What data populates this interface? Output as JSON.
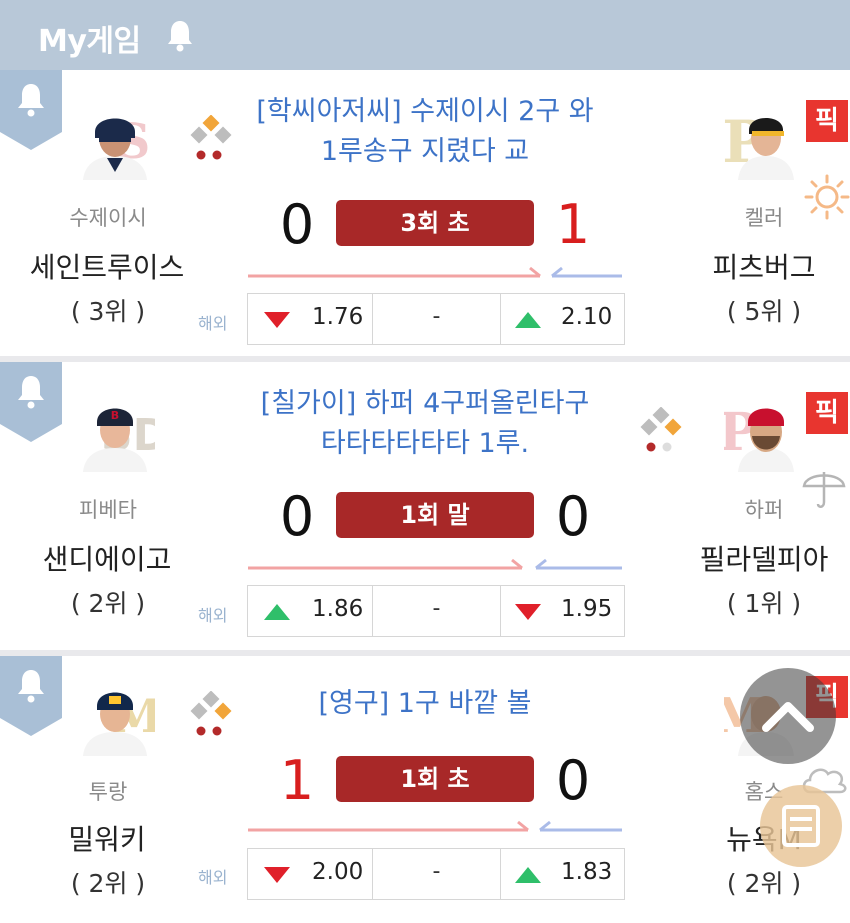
{
  "header": {
    "title": "My게임",
    "bell_icon": "bell-icon"
  },
  "colors": {
    "accent_red": "#a82828",
    "headline_blue": "#3d73c7",
    "pick_red": "#e8352f",
    "up_green": "#2fbf6a",
    "down_red": "#e0202a"
  },
  "games": [
    {
      "headline": [
        "[학씨아저씨] 수제이시 2구 와",
        "1루송구 지렸다 교"
      ],
      "inning": "3회 초",
      "away": {
        "pitcher": "수제이시",
        "team": "세인트루이스",
        "rank": "( 3위 )",
        "score": "0",
        "logo_letter": "S"
      },
      "home": {
        "pitcher": "켈러",
        "team": "피츠버그",
        "rank": "( 5위 )",
        "score": "1",
        "logo_letter": "P"
      },
      "weather": "sun-icon",
      "pick_label": "픽",
      "odds_label": "해외",
      "odds": {
        "away": "1.76",
        "draw": "-",
        "home": "2.10",
        "away_dir": "down",
        "home_dir": "up"
      }
    },
    {
      "headline": [
        "[칠가이] 하퍼 4구퍼올린타구",
        "타타타타타타 1루."
      ],
      "inning": "1회 말",
      "away": {
        "pitcher": "피베타",
        "team": "샌디에이고",
        "rank": "( 2위 )",
        "score": "0",
        "logo_letter": "SD"
      },
      "home": {
        "pitcher": "하퍼",
        "team": "필라델피아",
        "rank": "( 1위 )",
        "score": "0",
        "logo_letter": "P"
      },
      "weather": "umbrella-icon",
      "pick_label": "픽",
      "odds_label": "해외",
      "odds": {
        "away": "1.86",
        "draw": "-",
        "home": "1.95",
        "away_dir": "up",
        "home_dir": "down"
      }
    },
    {
      "headline": [
        "[영구] 1구 바깥 볼"
      ],
      "inning": "1회 초",
      "away": {
        "pitcher": "투랑",
        "team": "밀워키",
        "rank": "( 2위 )",
        "score": "1",
        "logo_letter": "M"
      },
      "home": {
        "pitcher": "홈스",
        "team": "뉴욕M",
        "rank": "( 2위 )",
        "score": "0",
        "logo_letter": "NY"
      },
      "weather": "cloud-icon",
      "pick_label": "픽",
      "odds_label": "해외",
      "odds": {
        "away": "2.00",
        "draw": "-",
        "home": "1.83",
        "away_dir": "down",
        "home_dir": "up"
      }
    }
  ]
}
